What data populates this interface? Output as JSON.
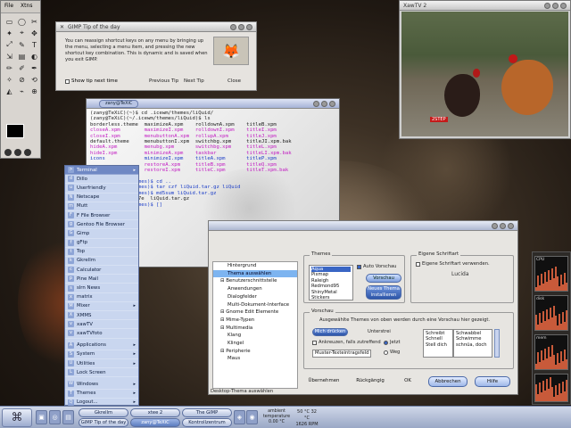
{
  "toolbox": {
    "menu": [
      "File",
      "Xtns"
    ],
    "tools": [
      "▭",
      "◯",
      "✂",
      "✦",
      "⌖",
      "✥",
      "⤢",
      "✎",
      "T",
      "⇲",
      "▤",
      "◐",
      "✏",
      "✐",
      "✒",
      "✧",
      "⊘",
      "⟲",
      "◭",
      "⌁",
      "⊕"
    ]
  },
  "tip": {
    "title": "GIMP Tip of the day",
    "text": "You can reassign shortcut keys on any menu by bringing up the menu, selecting a menu item, and pressing the new shortcut key combination. This is dynamic and is saved when you exit GIMP.",
    "show_next": "Show tip next time",
    "prev": "Previous Tip",
    "next": "Next Tip",
    "close": "Close"
  },
  "video": {
    "title": "XawTV 2",
    "label": "2STEP"
  },
  "terminal": {
    "tab": "zany@TeXiC",
    "lines": [
      {
        "cls": "c-dark",
        "t": "(zany@TeXiC)(~)$ cd .icewm/themes/liQuid/"
      },
      {
        "cls": "c-dark",
        "t": "(zany@TeXiC)(~/.icewm/themes/liQuid)$ ls"
      },
      {
        "cls": "c-dark",
        "t": "borderless.theme  maximizeA.xpm    rolldownA.xpm    titleB.xpm"
      },
      {
        "cls": "c-mag",
        "t": "closeA.xpm        maximizeI.xpm    rolldownI.xpm    titleI.xpm"
      },
      {
        "cls": "c-mag",
        "t": "closeI.xpm        menubuttonA.xpm  rollupA.xpm      titleJ.xpm"
      },
      {
        "cls": "c-dark",
        "t": "default.theme     menubuttonI.xpm  switchbg.xpm     titleJI.xpm.bak"
      },
      {
        "cls": "c-mag",
        "t": "hideA.xpm         menubg.xpm       switchbg.xpm     titleL.xpm"
      },
      {
        "cls": "c-mag",
        "t": "hideI.xpm         minimizeA.xpm    taskbar          titleLI.xpm.bak"
      },
      {
        "cls": "c-blue",
        "t": "icons             minimizeI.xpm    titleA.xpm       titleP.xpm"
      },
      {
        "cls": "c-mag",
        "t": "                  restoreA.xpm     titleB.xpm       titleQ.xpm"
      },
      {
        "cls": "c-mag",
        "t": "                  restoreI.xpm     titleC.xpm       titleT.xpm.bak"
      },
      {
        "cls": "c-dark",
        "t": ""
      },
      {
        "cls": "c-blue",
        "t": "      .icewm/themes)$ cd .."
      },
      {
        "cls": "c-blue",
        "t": "      .icewm/themes)$ tar czf liQuid.tar.gz liQuid"
      },
      {
        "cls": "c-blue",
        "t": "      .icewm/themes)$ md5sum liQuid.tar.gz"
      },
      {
        "cls": "c-dark",
        "t": "455e61b0b2f04c437e  liQuid.tar.gz"
      },
      {
        "cls": "c-blue",
        "t": "      .icewm/themes)$ []"
      }
    ]
  },
  "startmenu": {
    "items": [
      {
        "label": "Terminal",
        "icon": ">",
        "sub": true,
        "sel": true
      },
      {
        "label": "Dillo",
        "icon": "d"
      },
      {
        "label": "Userfriendly",
        "icon": "u"
      },
      {
        "label": "Netscape",
        "icon": "N"
      },
      {
        "label": "Mutt",
        "icon": "m"
      },
      {
        "label": "F File Browser",
        "icon": "F"
      },
      {
        "label": "Gentoo File Browser",
        "icon": "g"
      },
      {
        "label": "Gimp",
        "icon": "G"
      },
      {
        "label": "gFtp",
        "icon": "f"
      },
      {
        "label": "Top",
        "icon": "t"
      },
      {
        "label": "Gkrellm",
        "icon": "k"
      },
      {
        "label": "Calculator",
        "icon": "c"
      },
      {
        "label": "Pine Mail",
        "icon": "p"
      },
      {
        "label": "slrn News",
        "icon": "s"
      },
      {
        "label": "matrix",
        "icon": "x"
      },
      {
        "label": "Mixer",
        "icon": "M",
        "sub": true
      },
      {
        "label": "XMMS",
        "icon": "X"
      },
      {
        "label": "xawTV",
        "icon": "v"
      },
      {
        "label": "xawTVfoto",
        "icon": "v"
      },
      {
        "sep": true
      },
      {
        "label": "Applications",
        "icon": "A",
        "sub": true
      },
      {
        "label": "System",
        "icon": "S",
        "sub": true
      },
      {
        "label": "Utilities",
        "icon": "U",
        "sub": true
      },
      {
        "label": "Lock Screen",
        "icon": "L"
      },
      {
        "sep": true
      },
      {
        "label": "Windows",
        "icon": "W",
        "sub": true
      },
      {
        "label": "Themes",
        "icon": "T",
        "sub": true
      },
      {
        "label": "Logout...",
        "icon": "Q",
        "sub": true
      }
    ]
  },
  "settings": {
    "tree": [
      {
        "label": "Hintergrund",
        "level": 1
      },
      {
        "label": "Thema auswählen",
        "level": 1,
        "sel": true
      },
      {
        "label": "Benutzerschnittstelle",
        "level": 0
      },
      {
        "label": "Anwendungen",
        "level": 1
      },
      {
        "label": "Dialogfelder",
        "level": 1
      },
      {
        "label": "Multi-Dokument-Interface",
        "level": 1
      },
      {
        "label": "Gnome Edit Elemente",
        "level": 0
      },
      {
        "label": "Mime-Typen",
        "level": 0
      },
      {
        "label": "Multimedia",
        "level": 0
      },
      {
        "label": "Klang",
        "level": 1
      },
      {
        "label": "Klingel",
        "level": 1
      },
      {
        "label": "Peripherie",
        "level": 0
      },
      {
        "label": "Maus",
        "level": 1
      }
    ],
    "status": "Desktop-Thema auswählen",
    "themes_title": "Themes",
    "themes_list": [
      "Aqua",
      "Pixmap",
      "Raleigh",
      "Redmond95",
      "ShinyMetal",
      "Stickers"
    ],
    "auto_preview": "Auto Vorschau",
    "preview_btn": "Vorschau",
    "install_btn": "Neues Thema installieren",
    "font_title": "Eigene Schriftart",
    "font_check": "Eigene Schriftart verwenden.",
    "font_preview": "Lucida",
    "preview_title": "Vorschau",
    "preview_text": "Ausgewählte Themes von oben werden durch eine Vorschau hier gezeigt.",
    "press_me": "Mich drücken",
    "underline": "Unterstrei",
    "check_label": "Ankreuzen, falls zutreffend",
    "radio1": "Jetzt",
    "radio2": "Weg",
    "text_field": "Muster-Texteintragsfeld",
    "mini_list": [
      "Schreibt",
      "Schnell",
      "Stell dich"
    ],
    "mini_list2": [
      "Schwabbel",
      "Schwimme",
      "schnüa, doch"
    ],
    "btn_apply": "Übernehmen",
    "btn_revert": "Rückgängig",
    "btn_ok": "OK",
    "btn_cancel": "Abbrechen",
    "btn_help": "Hilfe"
  },
  "monitors": {
    "labels": [
      "CPU",
      "disk",
      "mem"
    ]
  },
  "taskbar": {
    "tasks": [
      {
        "label": "Gkrellm",
        "row": 0,
        "col": 0
      },
      {
        "label": "GIMP Tip of the day",
        "row": 1,
        "col": 0
      },
      {
        "label": "xtee 2",
        "row": 0,
        "col": 1
      },
      {
        "label": "zany@TeXiC",
        "row": 1,
        "col": 1,
        "active": true
      },
      {
        "label": "The GIMP",
        "row": 0,
        "col": 2
      },
      {
        "label": "Kontrollzentrum",
        "row": 1,
        "col": 2
      }
    ],
    "temp_label": "ambient temperature",
    "temp_value": "0.00 °C",
    "clock_line1": "50 °C 32 °C",
    "clock_line2": "1626 RPM"
  }
}
